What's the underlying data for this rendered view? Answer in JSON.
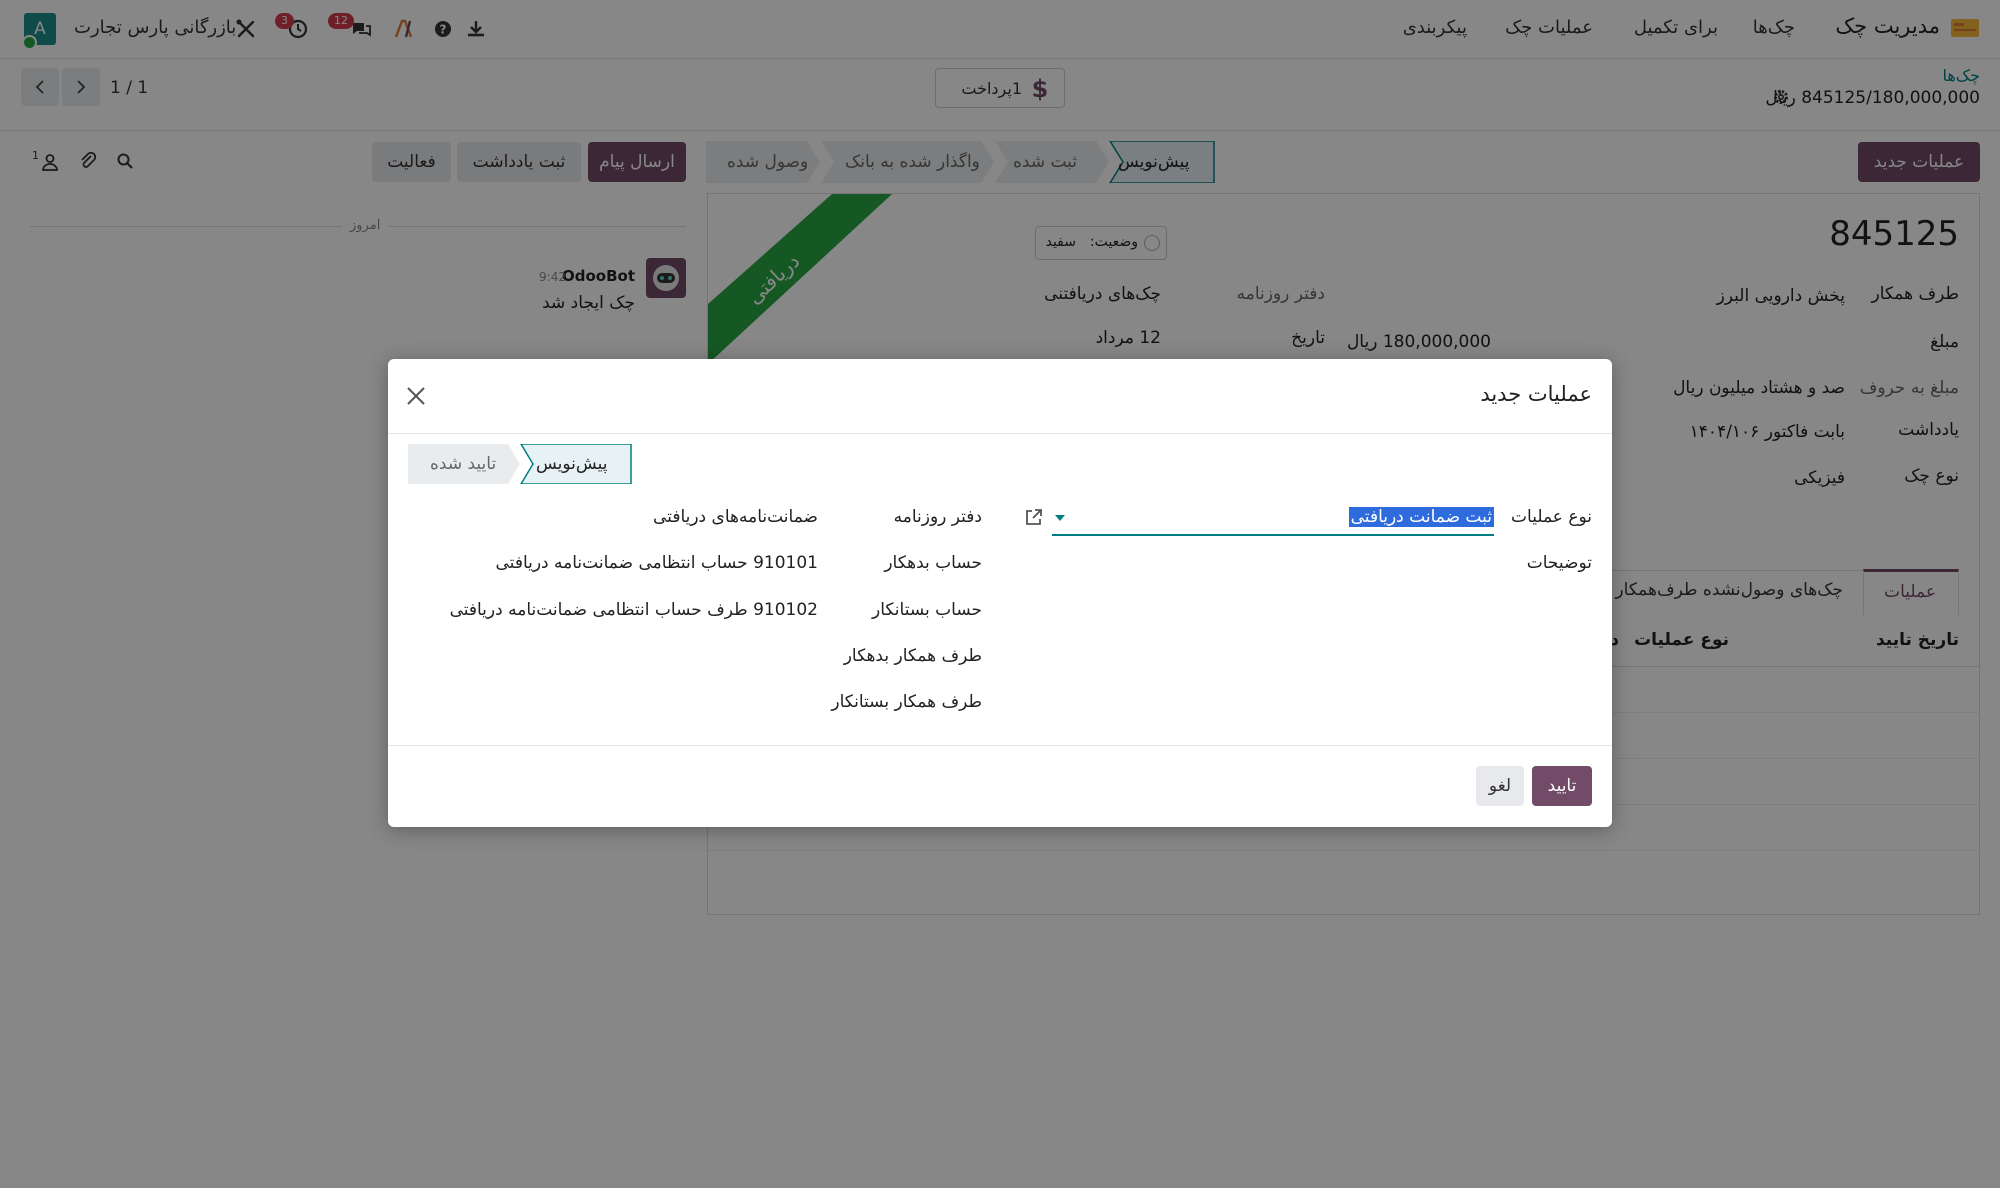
{
  "navbar": {
    "brand": "مدیریت چک",
    "menu": [
      "چک‌ها",
      "برای تکمیل",
      "عملیات چک",
      "پیکربندی"
    ],
    "company": "بازرگانی پارس تجارت",
    "avatar_letter": "A",
    "messages_count": "12",
    "activities_count": "3"
  },
  "control_panel": {
    "breadcrumb": "چک‌ها",
    "record": "845125/180,000,000 ریال",
    "pay_button": "1پرداخت",
    "pager": "1 / 1"
  },
  "statusbar": {
    "new_operation_button": "عملیات جدید",
    "stages": [
      "پیش‌نویس",
      "ثبت شده",
      "واگذار شده به بانک",
      "وصول شده"
    ],
    "active_stage": "پیش‌نویس"
  },
  "chatter": {
    "send_message": "ارسال پیام",
    "log_note": "ثبت یادداشت",
    "activity": "فعالیت",
    "followers_count": "1",
    "date_separator": "امروز",
    "message": {
      "author": "OdooBot",
      "time": "9:42",
      "body": "چک ایجاد شد"
    }
  },
  "form": {
    "title": "845125",
    "ribbon": "دریافتی",
    "status_label": "وضعیت:",
    "status_value": "سفید",
    "fields": {
      "partner_label": "طرف همکار",
      "partner_value": "پخش دارویی البرز",
      "amount_label": "مبلغ",
      "amount_value": "180,000,000 ریال",
      "amount_words_label": "مبلغ به حروف",
      "amount_words_value": "صد و هشتاد میلیون ریال",
      "note_label": "یادداشت",
      "note_value": "بابت فاکتور ۱۴۰۴/۱۰۶",
      "type_label": "نوع چک",
      "type_value": "فیزیکی",
      "journal_label": "دفتر روزنامه",
      "journal_value": "چک‌های دریافتنی",
      "date_label": "تاریخ",
      "date_value": "12 مرداد"
    },
    "tabs": [
      "عملیات",
      "چک‌های وصول‌نشده طرف‌همکار"
    ],
    "table_headers": [
      "تاریخ تایید",
      "نوع عملیات",
      "د"
    ]
  },
  "modal": {
    "title": "عملیات جدید",
    "stages": [
      "پیش‌نویس",
      "تایید شده"
    ],
    "operation_type_label": "نوع عملیات",
    "operation_type_value": "ثبت ضمانت دریافتی",
    "description_label": "توضیحات",
    "journal_label": "دفتر روزنامه",
    "journal_value": "ضمانت‌نامه‌های دریافتی",
    "debit_account_label": "حساب بدهکار",
    "debit_account_value": "910101 حساب انتظامی ضمانت‌نامه دریافتی",
    "credit_account_label": "حساب بستانکار",
    "credit_account_value": "910102 طرف حساب انتظامی ضمانت‌نامه دریافتی",
    "debit_partner_label": "طرف همکار بدهکار",
    "credit_partner_label": "طرف همکار بستانکار",
    "confirm_button": "تایید",
    "cancel_button": "لغو"
  },
  "colors": {
    "primary": "#714b67",
    "accent_teal": "#017e84",
    "ribbon_green": "#28a745",
    "badge_red": "#d33c4f"
  }
}
